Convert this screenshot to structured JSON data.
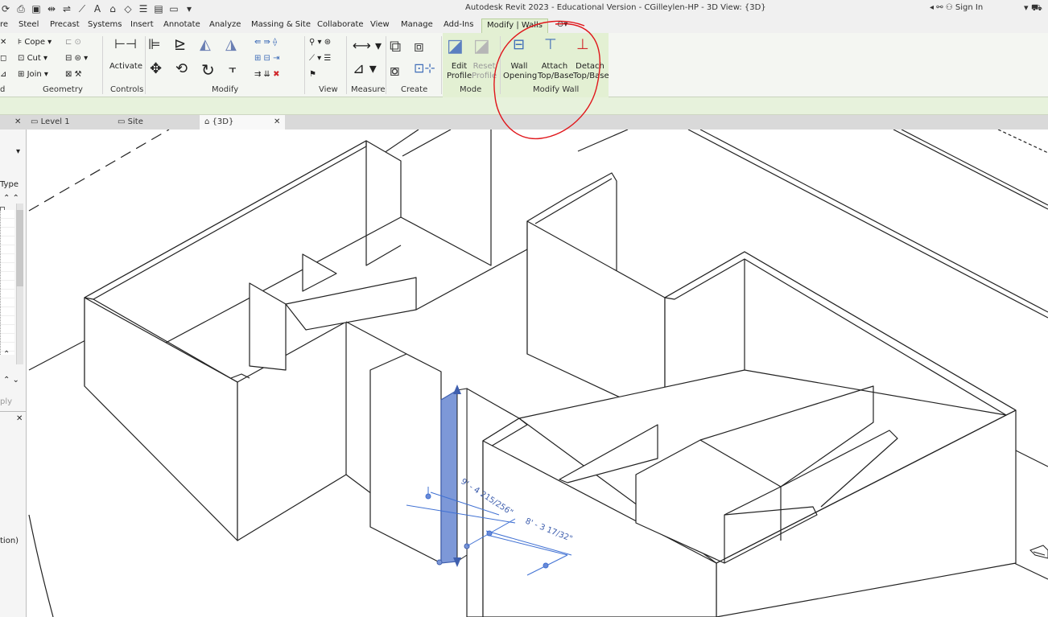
{
  "window": {
    "title": "Autodesk Revit 2023 - Educational Version - CGilleylen-HP - 3D View: {3D}",
    "sign_in": "Sign In"
  },
  "ribbon_tabs": [
    {
      "label": "re",
      "active": false
    },
    {
      "label": "Steel",
      "active": false
    },
    {
      "label": "Precast",
      "active": false
    },
    {
      "label": "Systems",
      "active": false
    },
    {
      "label": "Insert",
      "active": false
    },
    {
      "label": "Annotate",
      "active": false
    },
    {
      "label": "Analyze",
      "active": false
    },
    {
      "label": "Massing & Site",
      "active": false
    },
    {
      "label": "Collaborate",
      "active": false
    },
    {
      "label": "View",
      "active": false
    },
    {
      "label": "Manage",
      "active": false
    },
    {
      "label": "Add-Ins",
      "active": false
    },
    {
      "label": "Modify | Walls",
      "active": true
    }
  ],
  "ribbon": {
    "geometry": {
      "cope": "Cope",
      "cut": "Cut",
      "join": "Join",
      "label": "Geometry"
    },
    "controls": {
      "activate": "Activate",
      "label": "Controls"
    },
    "modify_label": "Modify",
    "view_label": "View",
    "measure_label": "Measure",
    "create_label": "Create",
    "mode": {
      "edit_profile_1": "Edit",
      "edit_profile_2": "Profile",
      "reset_profile_1": "Reset",
      "reset_profile_2": "Profile",
      "label": "Mode"
    },
    "modify_wall": {
      "wall_opening_1": "Wall",
      "wall_opening_2": "Opening",
      "attach_1": "Attach",
      "attach_2": "Top/Base",
      "detach_1": "Detach",
      "detach_2": "Top/Base",
      "label": "Modify Wall"
    },
    "left_edge_label": "d"
  },
  "view_tabs": [
    {
      "label": "Level 1",
      "active": false
    },
    {
      "label": "Site",
      "active": false
    },
    {
      "label": "{3D}",
      "active": true
    }
  ],
  "properties": {
    "type_label": "Type",
    "apply": "ply",
    "partial_text": "tion)"
  },
  "dimensions": {
    "height": "9' - 4 215/256\"",
    "length": "8' - 3 17/32\""
  },
  "colors": {
    "contextual_green": "#e3f0d3",
    "selected_wall": "#7d98d8",
    "annotation_red": "#e0161b",
    "dimension_blue": "#3f70d3"
  }
}
